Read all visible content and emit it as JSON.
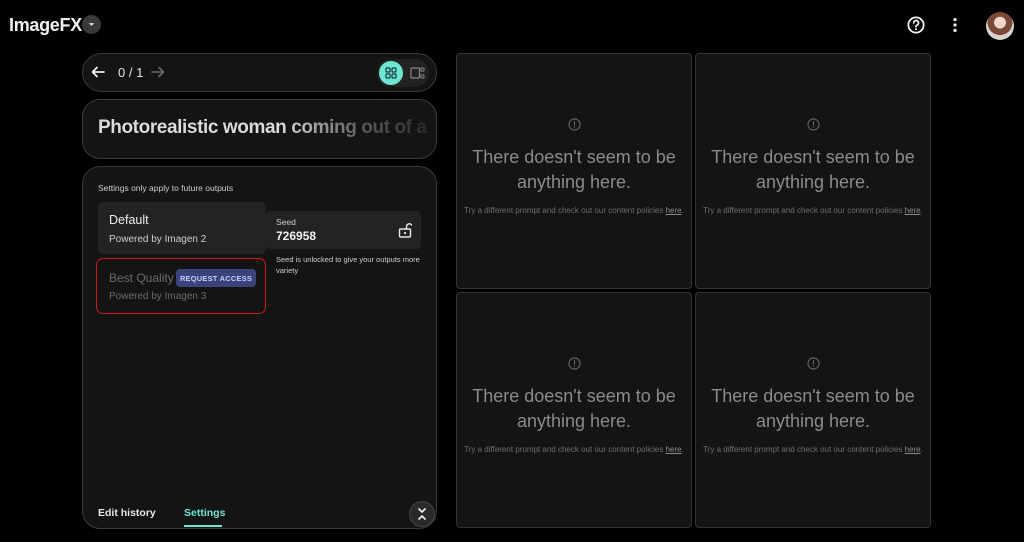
{
  "app": {
    "name": "ImageFX"
  },
  "nav": {
    "counter": "0 / 1"
  },
  "prompt": {
    "text": "Photorealistic woman coming out of a"
  },
  "settings": {
    "note": "Settings only apply to future outputs",
    "models": [
      {
        "name": "Default",
        "powered_by": "Powered by Imagen 2"
      },
      {
        "name": "Best Quality",
        "powered_by": "Powered by Imagen 3",
        "badge": "REQUEST ACCESS"
      }
    ],
    "seed": {
      "label": "Seed",
      "value": "726958",
      "hint": "Seed is unlocked to give your outputs more variety"
    }
  },
  "tabs": {
    "history": "Edit history",
    "settings": "Settings"
  },
  "empty_tile": {
    "title": "There doesn't seem to be anything here.",
    "sub_prefix": "Try a different prompt and check out our content policies",
    "link": "here",
    "sub_suffix": "."
  },
  "colors": {
    "accent": "#6fe6d4",
    "highlight": "#d11a1a",
    "badge_bg": "#3b437c"
  }
}
